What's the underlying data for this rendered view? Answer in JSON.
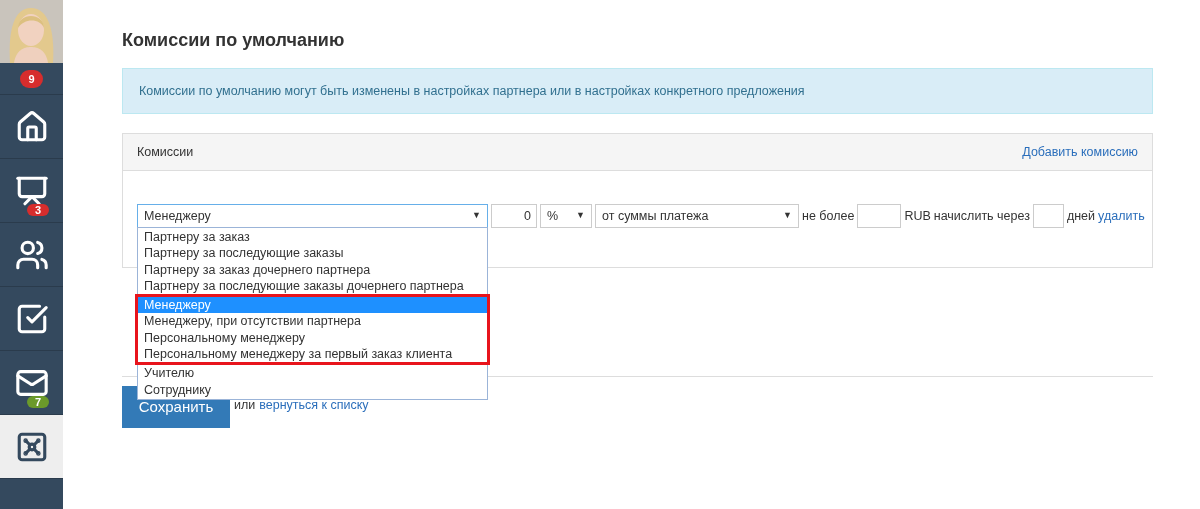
{
  "sidebar": {
    "items": [
      {
        "kind": "avatar"
      },
      {
        "kind": "badge-row",
        "badge": "9",
        "color": "#d62d2d"
      },
      {
        "kind": "home",
        "selected": false
      },
      {
        "kind": "chart",
        "badge": "3",
        "color": "#d62d2d",
        "selected": false
      },
      {
        "kind": "users",
        "selected": false
      },
      {
        "kind": "tasks",
        "selected": false
      },
      {
        "kind": "mail",
        "badge": "7",
        "color": "#6b9a2a",
        "selected": false
      },
      {
        "kind": "safe",
        "selected": true
      }
    ]
  },
  "title": "Комиссии по умолчанию",
  "info": "Комиссии по умолчанию могут быть изменены в настройках партнера или в настройках конкретного предложения",
  "panel": {
    "title": "Комиссии",
    "add_link": "Добавить комиссию",
    "row": {
      "recipient": "Менеджеру",
      "recipient_caret": "▼",
      "amount": "0",
      "unit": "%",
      "unit_caret": "▼",
      "base": "от суммы платежа",
      "base_caret": "▼",
      "max_label": "не более",
      "currency": "RUB",
      "delay_label": "начислить через",
      "days_label": "дней",
      "delete_link": "удалить"
    }
  },
  "dropdown": {
    "options": [
      {
        "label": "Партнеру за заказ",
        "selected": false,
        "highlighted": false
      },
      {
        "label": "Партнеру за последующие заказы",
        "selected": false,
        "highlighted": false
      },
      {
        "label": "Партнеру за заказ дочернего партнера",
        "selected": false,
        "highlighted": false
      },
      {
        "label": "Партнеру за последующие заказы дочернего партнера",
        "selected": false,
        "highlighted": false
      },
      {
        "label": "Менеджеру",
        "selected": true,
        "highlighted": true
      },
      {
        "label": "Менеджеру, при отсутствии партнера",
        "selected": false,
        "highlighted": true
      },
      {
        "label": "Персональному менеджеру",
        "selected": false,
        "highlighted": true
      },
      {
        "label": "Персональному менеджеру за первый заказ клиента",
        "selected": false,
        "highlighted": true
      },
      {
        "label": "Учителю",
        "selected": false,
        "highlighted": false
      },
      {
        "label": "Сотруднику",
        "selected": false,
        "highlighted": false
      }
    ]
  },
  "footer": {
    "save": "Сохранить",
    "or": "или",
    "back_link": "вернуться к списку"
  }
}
